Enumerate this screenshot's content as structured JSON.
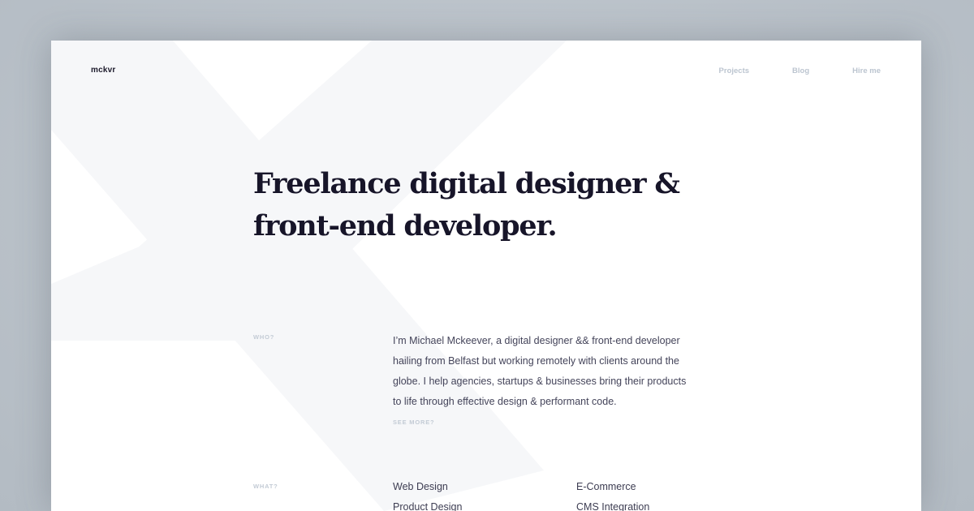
{
  "site": {
    "logo": "mckvr"
  },
  "nav": {
    "items": [
      "Projects",
      "Blog",
      "Hire me"
    ]
  },
  "hero": {
    "headline_line1": "Freelance digital designer &",
    "headline_line2": "front-end developer."
  },
  "who": {
    "label": "WHO?",
    "bio_lines": [
      "I’m Michael Mckeever, a digital designer && front-end developer",
      "hailing from Belfast but working remotely with clients around the",
      "globe. I help agencies, startups & businesses bring their products",
      "to life through effective design & performant code."
    ],
    "see_more": "SEE MORE?"
  },
  "what": {
    "label": "WHAT?",
    "services": [
      "Web Design",
      "E-Commerce",
      "Product Design",
      "CMS Integration"
    ]
  },
  "colors": {
    "page_backdrop": "#b8c0c8",
    "heading": "#171529",
    "body_text": "#44445a",
    "muted_label": "#c3cbd5",
    "nav_link": "#bcc5d0",
    "bg_mark": "#f6f7f9"
  }
}
